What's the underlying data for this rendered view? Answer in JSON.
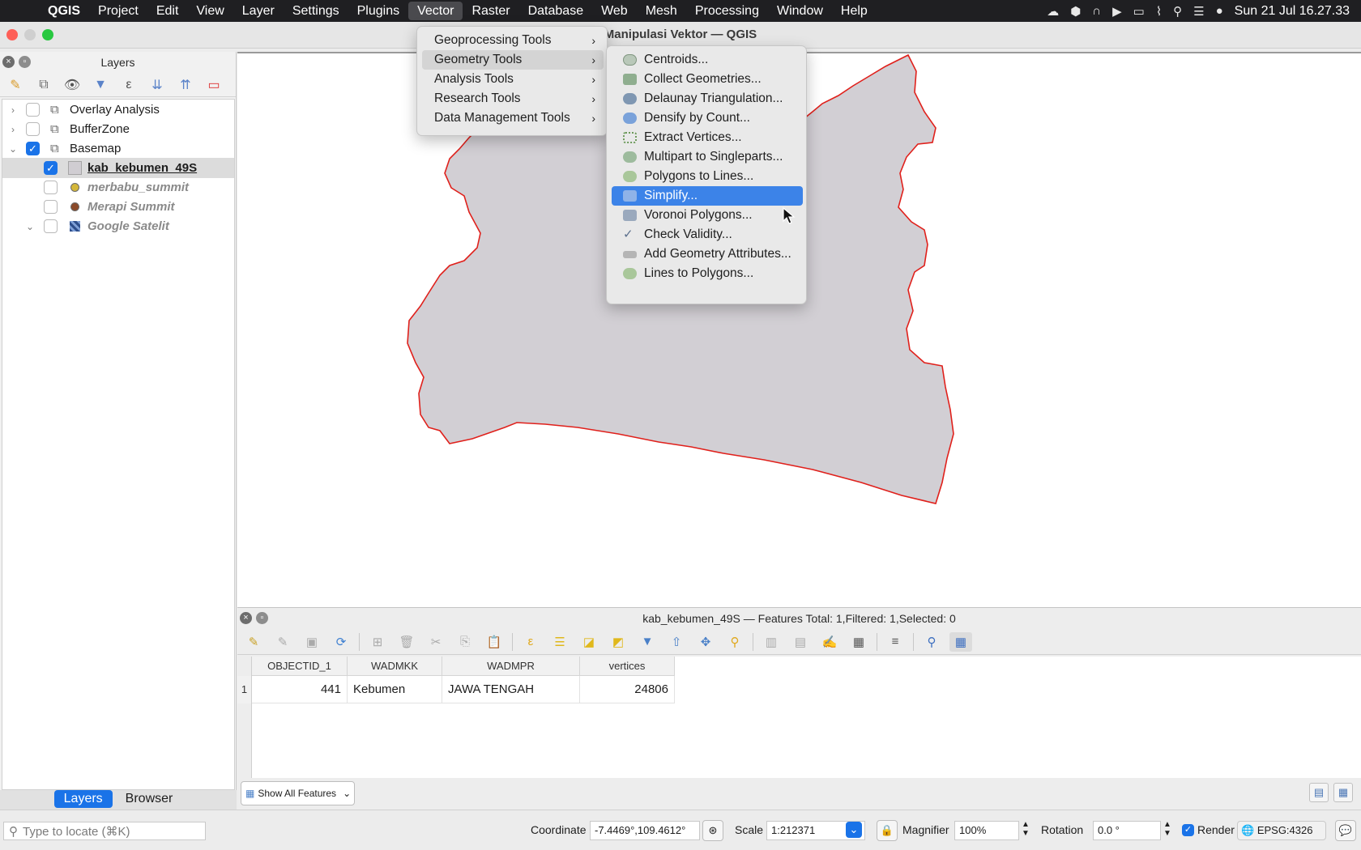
{
  "os_menubar": {
    "app_name": "QGIS",
    "items": [
      "Project",
      "Edit",
      "View",
      "Layer",
      "Settings",
      "Plugins",
      "Vector",
      "Raster",
      "Database",
      "Web",
      "Mesh",
      "Processing",
      "Window",
      "Help"
    ],
    "active_item": "Vector",
    "clock": "Sun 21 Jul  16.27.33"
  },
  "window": {
    "title": "Manipulasi Vektor — QGIS"
  },
  "layers_panel": {
    "title": "Layers",
    "tabs": [
      "Layers",
      "Browser"
    ],
    "active_tab": "Layers",
    "layers": [
      {
        "name": "Overlay Analysis",
        "type": "group",
        "checked": false,
        "expanded": false
      },
      {
        "name": "BufferZone",
        "type": "group",
        "checked": false,
        "expanded": false
      },
      {
        "name": "Basemap",
        "type": "group",
        "checked": true,
        "expanded": true
      },
      {
        "name": "kab_kebumen_49S",
        "type": "polygon",
        "checked": true,
        "selected": true,
        "color": "#d0cdd2"
      },
      {
        "name": "merbabu_summit",
        "type": "point",
        "checked": false,
        "color": "#d4b73a"
      },
      {
        "name": "Merapi Summit",
        "type": "point",
        "checked": false,
        "color": "#8b4a2a"
      },
      {
        "name": "Google Satelit",
        "type": "raster",
        "checked": false
      }
    ]
  },
  "vector_menu": {
    "items": [
      {
        "label": "Geoprocessing Tools",
        "has_submenu": true
      },
      {
        "label": "Geometry Tools",
        "has_submenu": true,
        "active": true
      },
      {
        "label": "Analysis Tools",
        "has_submenu": true
      },
      {
        "label": "Research Tools",
        "has_submenu": true
      },
      {
        "label": "Data Management Tools",
        "has_submenu": true
      }
    ]
  },
  "geometry_submenu": {
    "items": [
      {
        "label": "Centroids...",
        "icon": "centroids-icon",
        "color": "#8aa08a"
      },
      {
        "label": "Collect Geometries...",
        "icon": "collect-geometries-icon",
        "color": "#6d8f6d"
      },
      {
        "label": "Delaunay Triangulation...",
        "icon": "delaunay-icon",
        "color": "#5f7d9c"
      },
      {
        "label": "Densify by Count...",
        "icon": "densify-icon",
        "color": "#5b87c4"
      },
      {
        "label": "Extract Vertices...",
        "icon": "extract-vertices-icon",
        "color": "#6c9a5a"
      },
      {
        "label": "Multipart to Singleparts...",
        "icon": "multipart-icon",
        "color": "#6e9a6e"
      },
      {
        "label": "Polygons to Lines...",
        "icon": "polygons-to-lines-icon",
        "color": "#7aa06a"
      },
      {
        "label": "Simplify...",
        "icon": "simplify-icon",
        "color": "#8fb3e8",
        "highlighted": true
      },
      {
        "label": "Voronoi Polygons...",
        "icon": "voronoi-icon",
        "color": "#7b8ea6"
      },
      {
        "label": "Check Validity...",
        "icon": "check-validity-icon",
        "color": "#5b6f8c"
      },
      {
        "label": "Add Geometry Attributes...",
        "icon": "add-geometry-attributes-icon",
        "color": "#8c8c8c"
      },
      {
        "label": "Lines to Polygons...",
        "icon": "lines-to-polygons-icon",
        "color": "#7aa06a"
      }
    ]
  },
  "map": {
    "fill_color": "#d2cfd4",
    "stroke_color": "#e0201b"
  },
  "attribute_table": {
    "title": "kab_kebumen_49S — Features Total: 1,Filtered: 1,Selected: 0",
    "columns": [
      "OBJECTID_1",
      "WADMKK",
      "WADMPR",
      "vertices"
    ],
    "rows": [
      {
        "row_number": "1",
        "cells": [
          "441",
          "Kebumen",
          "JAWA TENGAH",
          "24806"
        ]
      }
    ],
    "show_all_label": "Show All Features"
  },
  "status_bar": {
    "locate_placeholder": "Type to locate (⌘K)",
    "coordinate_label": "Coordinate",
    "coordinate_value": "-7.4469°,109.4612°",
    "scale_label": "Scale",
    "scale_value": "1:212371",
    "magnifier_label": "Magnifier",
    "magnifier_value": "100%",
    "rotation_label": "Rotation",
    "rotation_value": "0.0 °",
    "render_label": "Render",
    "render_checked": true,
    "crs_label": "EPSG:4326"
  }
}
